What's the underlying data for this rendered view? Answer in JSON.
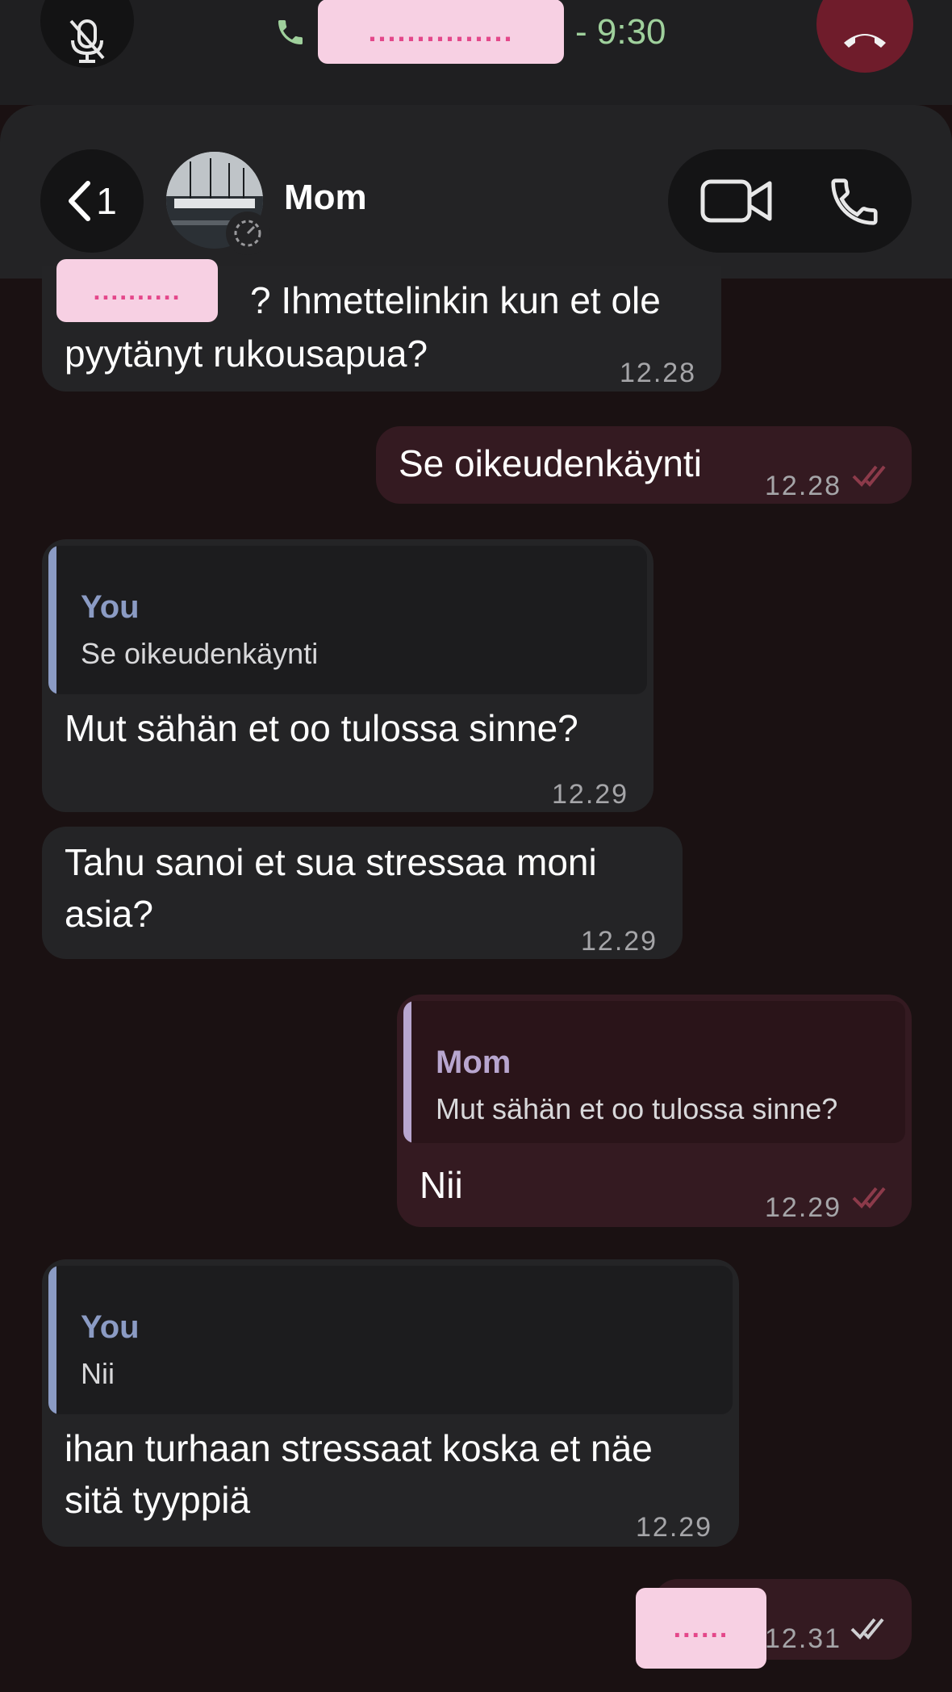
{
  "call_bar": {
    "contact_redacted": "...............",
    "duration": "- 9:30",
    "colors": {
      "accent": "#9fd09c",
      "end_call": "#6f1c2b",
      "redaction": "#f7d0e3"
    }
  },
  "header": {
    "back_count": "1",
    "contact_name": "Mom"
  },
  "messages": [
    {
      "direction": "incoming",
      "redacted_prefix": "..........",
      "line1": "? Ihmettelinkin kun et ole",
      "line2": "pyytänyt rukousapua?",
      "time": "12.28"
    },
    {
      "direction": "outgoing",
      "text": "Se oikeudenkäynti",
      "time": "12.28"
    },
    {
      "direction": "incoming",
      "quote": {
        "author": "You",
        "text": "Se oikeudenkäynti"
      },
      "text": "Mut sähän et oo tulossa sinne?",
      "time": "12.29"
    },
    {
      "direction": "incoming",
      "line1": "Tahu sanoi et sua stressaa moni",
      "line2": "asia?",
      "time": "12.29"
    },
    {
      "direction": "outgoing",
      "quote": {
        "author": "Mom",
        "text": "Mut sähän et oo tulossa sinne?"
      },
      "text": "Nii",
      "time": "12.29"
    },
    {
      "direction": "incoming",
      "quote": {
        "author": "You",
        "text": "Nii"
      },
      "line1": "ihan turhaan stressaat koska et näe",
      "line2": "sitä tyyppiä",
      "time": "12.29"
    },
    {
      "direction": "outgoing",
      "redacted_text": "......",
      "time": "12.31"
    }
  ]
}
